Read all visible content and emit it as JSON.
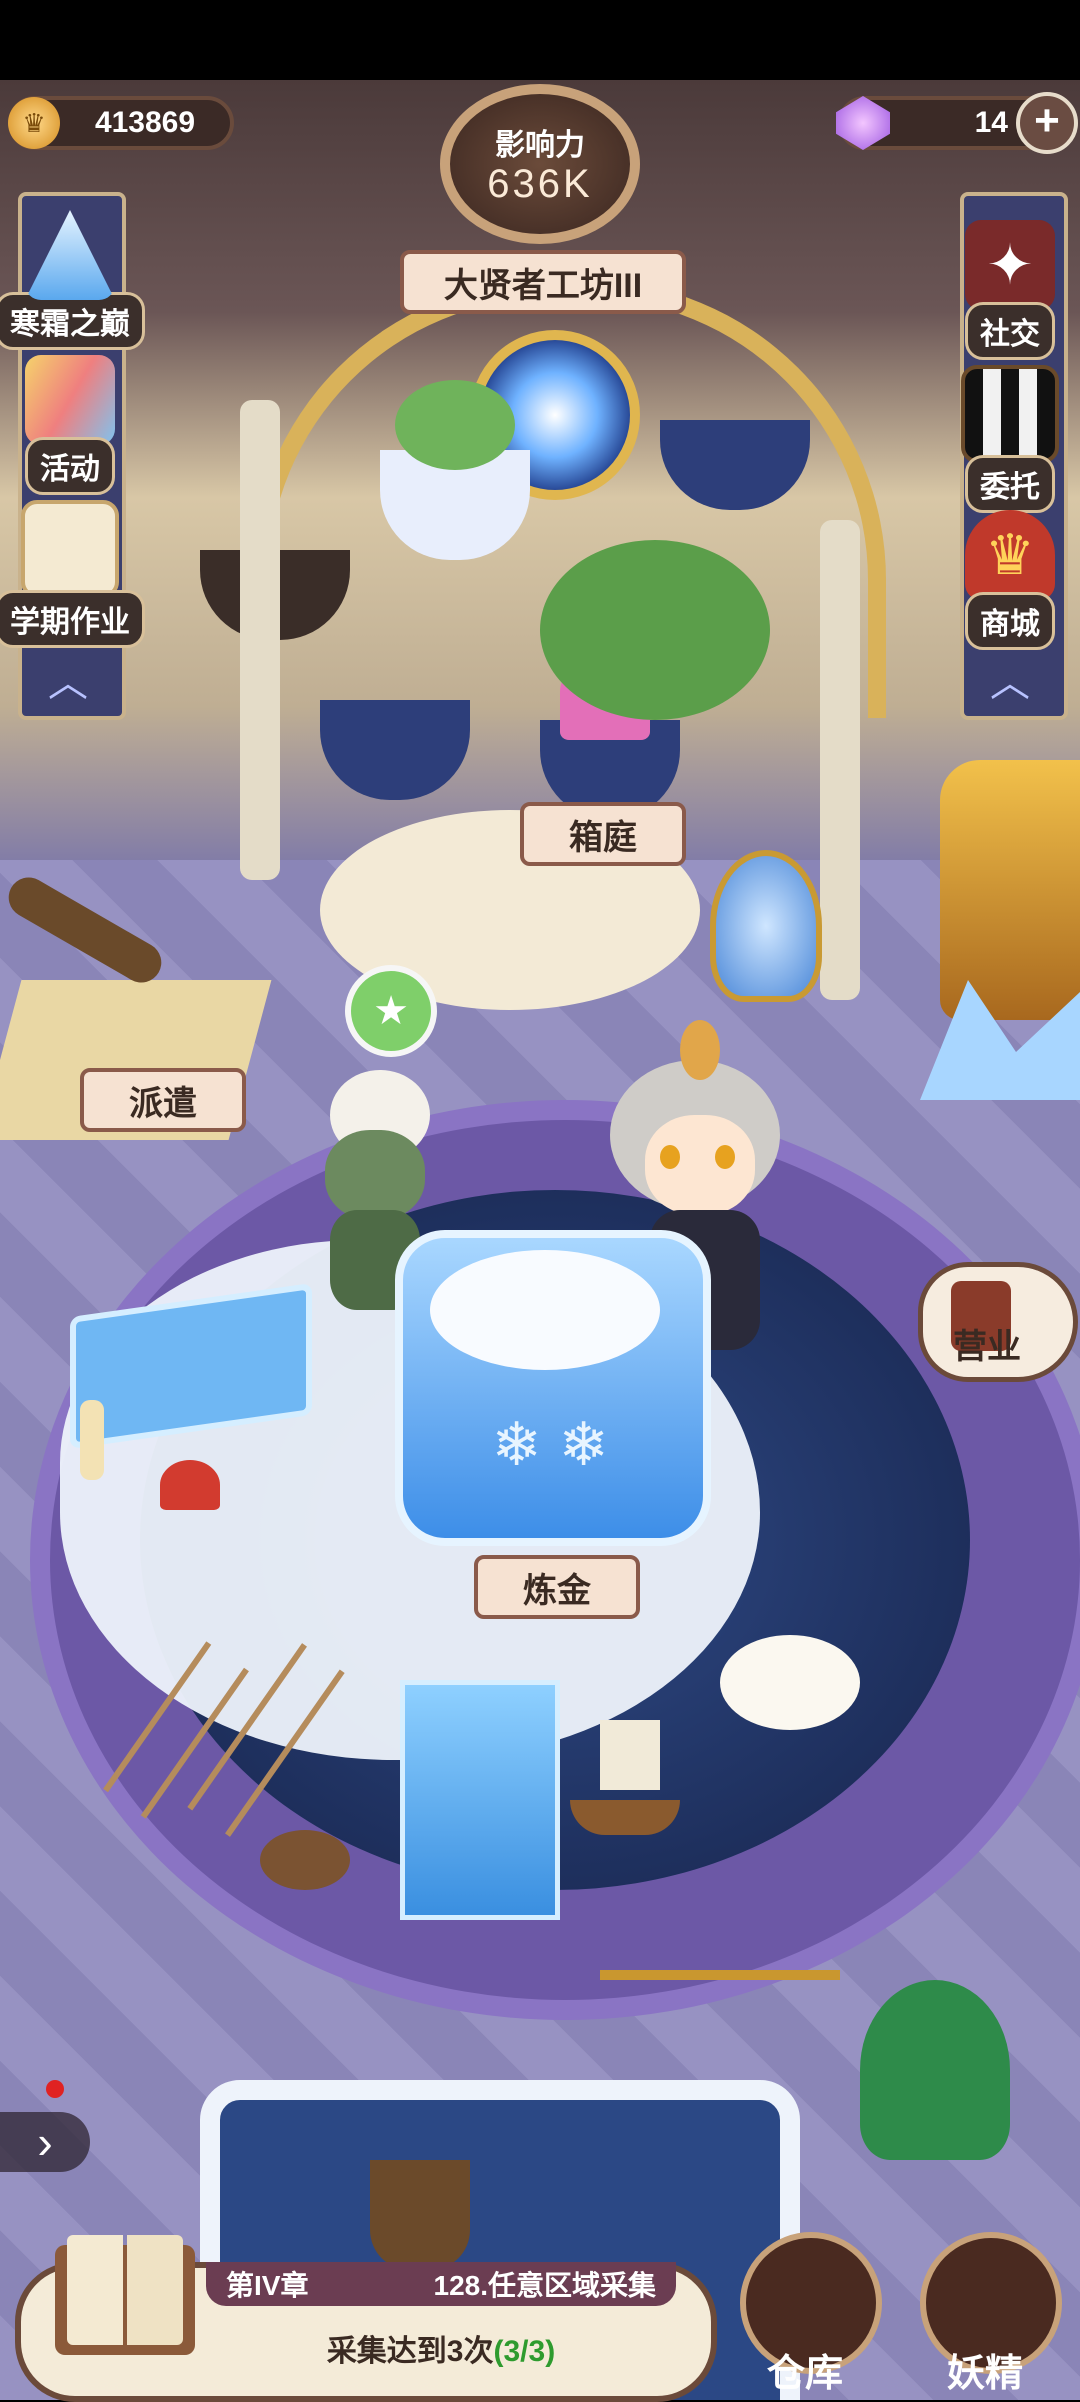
{
  "hud": {
    "coins": "413869",
    "gems": "14",
    "influence_label": "影响力",
    "influence_value": "636K",
    "workshop_title": "大贤者工坊III"
  },
  "left_menu": [
    {
      "label": "寒霜之巅",
      "icon": "snow-mountain-icon"
    },
    {
      "label": "活动",
      "icon": "rainbow-card-icon"
    },
    {
      "label": "学期作业",
      "icon": "scroll-icon"
    }
  ],
  "right_menu": [
    {
      "label": "社交",
      "icon": "birds-icon"
    },
    {
      "label": "委托",
      "icon": "qr-board-icon"
    },
    {
      "label": "商城",
      "icon": "shop-icon"
    }
  ],
  "scene_labels": {
    "garden": "箱庭",
    "dispatch": "派遣",
    "business": "营业",
    "alchemy": "炼金"
  },
  "quest": {
    "chapter": "第IV章",
    "task": "128.任意区域采集",
    "detail": "采集达到3次",
    "progress": "(3/3)"
  },
  "bottom_buttons": {
    "warehouse": "仓库",
    "fairy": "妖精"
  },
  "colors": {
    "progress_green": "#2e9b2e",
    "banner_blue": "#3b3f6e",
    "ribbon_pink": "#f6e2d2"
  }
}
